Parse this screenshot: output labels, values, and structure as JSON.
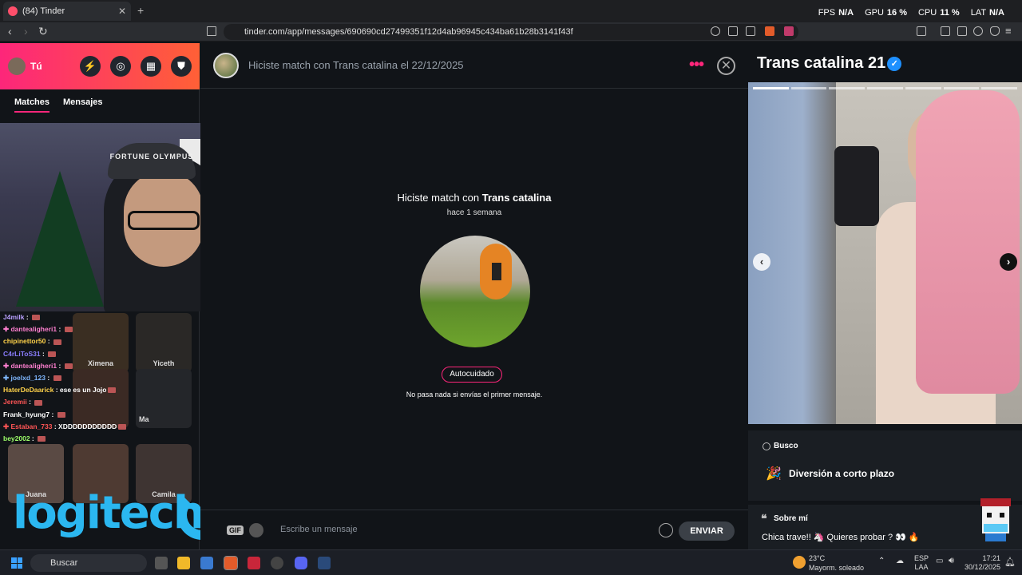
{
  "browser": {
    "tab_title": "(84) Tinder",
    "tab_close": "✕",
    "new_tab": "+",
    "url": "tinder.com/app/messages/690690cd27499351f12d4ab96945c434ba61b28b3141f43f",
    "perf": {
      "fps_label": "FPS",
      "fps_value": "N/A",
      "gpu_label": "GPU",
      "gpu_value": "16 %",
      "cpu_label": "CPU",
      "cpu_value": "11 %",
      "lat_label": "LAT",
      "lat_value": "N/A"
    }
  },
  "sidebar": {
    "user_label": "Tú",
    "tabs": {
      "matches": "Matches",
      "messages": "Mensajes"
    },
    "stream_chat": [
      {
        "user": "J4milk",
        "color": "#b9a0ff",
        "text": ""
      },
      {
        "user": "✚ dantealigheri1",
        "color": "#ff7fd0",
        "text": ""
      },
      {
        "user": "chipinettor50",
        "color": "#ffd24a",
        "text": ""
      },
      {
        "user": "C4rLiToS31",
        "color": "#8a7dff",
        "text": ""
      },
      {
        "user": "✚ dantealigheri1",
        "color": "#ff7fd0",
        "text": ""
      },
      {
        "user": "✚ joelxd_123",
        "color": "#7fb8ff",
        "text": ""
      },
      {
        "user": "HaterDeDaarick",
        "color": "#ffd24a",
        "text": "ese es un Jojo"
      },
      {
        "user": "Jeremii",
        "color": "#ff5555",
        "text": ""
      },
      {
        "user": "Frank_hyung7",
        "color": "#ffffff",
        "text": ""
      },
      {
        "user": "✚ Estaban_733",
        "color": "#ff5555",
        "text": "XDDDDDDDDDDD"
      },
      {
        "user": "bey2002",
        "color": "#9dff6a",
        "text": ""
      }
    ],
    "match_names": [
      "Ximena",
      "Yiceth",
      "Ma",
      "Juana",
      "Camila"
    ],
    "webcam_cap_text": "FORTUNE OLYMPUS",
    "logo": "logitech"
  },
  "chat": {
    "header_title": "Hiciste match con Trans catalina el 22/12/2025",
    "match_prefix": "Hiciste match con ",
    "match_name": "Trans catalina",
    "match_ago": "hace 1 semana",
    "tag": "Autocuidado",
    "hint": "No pasa nada si envías el primer mensaje.",
    "gif_label": "GIF",
    "input_placeholder": "Escribe un mensaje",
    "send_label": "ENVIAR"
  },
  "profile": {
    "name": "Trans catalina",
    "age": "21",
    "photo_count": 7,
    "photo_index": 1,
    "looking_label": "Busco",
    "looking_value": "Diversión a corto plazo",
    "about_label": "Sobre mí",
    "about_text": "Chica trave!! 🦄 Quieres probar ? 👀 🔥"
  },
  "taskbar": {
    "search_placeholder": "Buscar",
    "weather_temp": "23°C",
    "weather_desc": "Mayorm. soleado",
    "lang": "ESP",
    "region": "LAA",
    "time": "17:21",
    "date": "30/12/2025"
  },
  "colors": {
    "brand_gradient_start": "#fd267a",
    "brand_gradient_end": "#ff6036",
    "verified": "#1e90ff"
  }
}
